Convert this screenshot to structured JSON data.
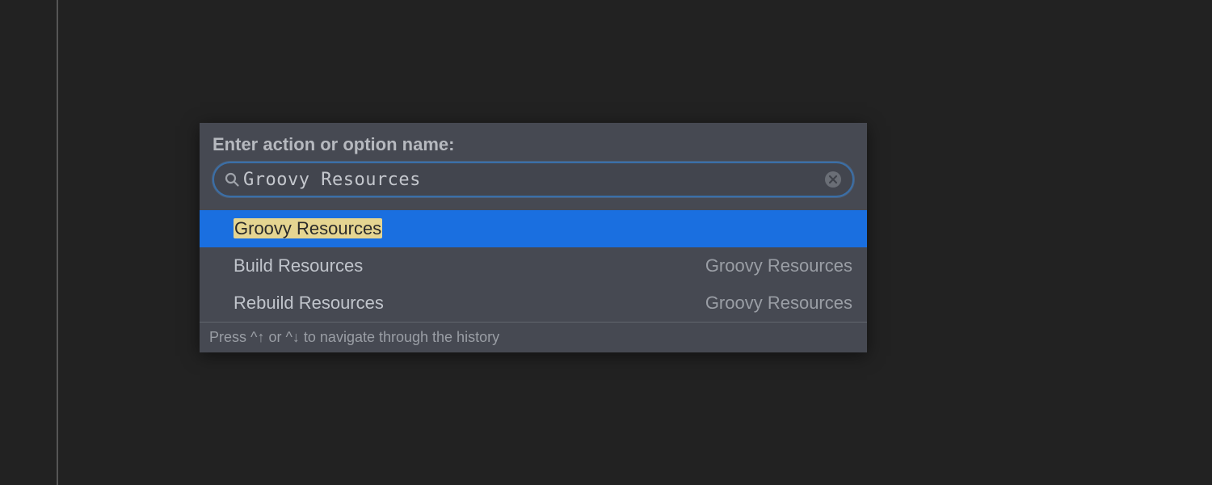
{
  "popup": {
    "title": "Enter action or option name:",
    "search": {
      "value": "Groovy Resources",
      "placeholder": ""
    },
    "results": [
      {
        "label": "Groovy Resources",
        "category": "",
        "selected": true,
        "highlighted": true
      },
      {
        "label": "Build Resources",
        "category": "Groovy Resources",
        "selected": false,
        "highlighted": false
      },
      {
        "label": "Rebuild Resources",
        "category": "Groovy Resources",
        "selected": false,
        "highlighted": false
      }
    ],
    "footer": "Press ^↑ or ^↓ to navigate through the history"
  },
  "icons": {
    "search": "search-icon",
    "clear": "clear-icon"
  }
}
